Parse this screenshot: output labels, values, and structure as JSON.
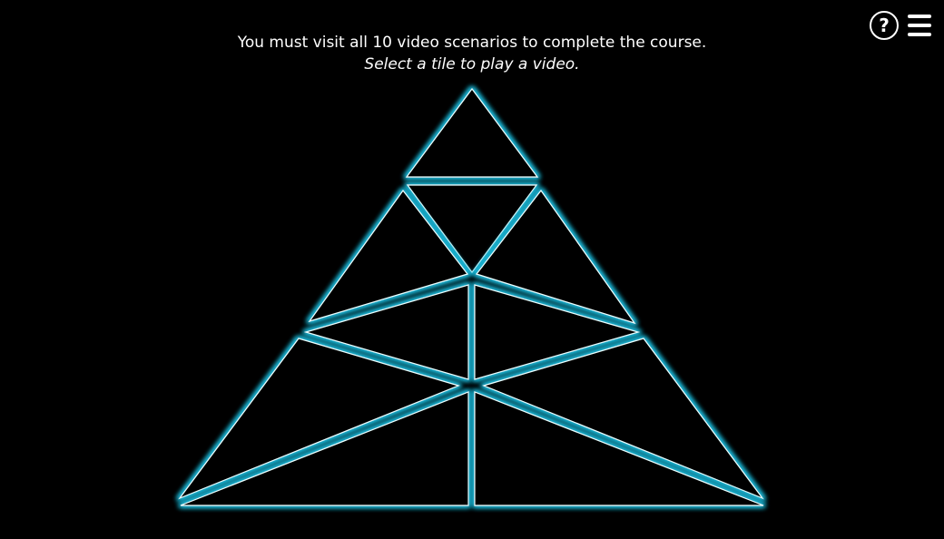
{
  "instructions": {
    "line1": "You must visit all 10 video scenarios to complete the course.",
    "line2": "Select a tile to play a video."
  },
  "controls": {
    "help_label": "?",
    "help_icon": "question-circle-icon",
    "menu_icon": "hamburger-menu-icon"
  },
  "tiles": {
    "count": 10,
    "glow_color": "#1fb8d8",
    "stroke_color": "#eaffff",
    "background": "#000000"
  }
}
